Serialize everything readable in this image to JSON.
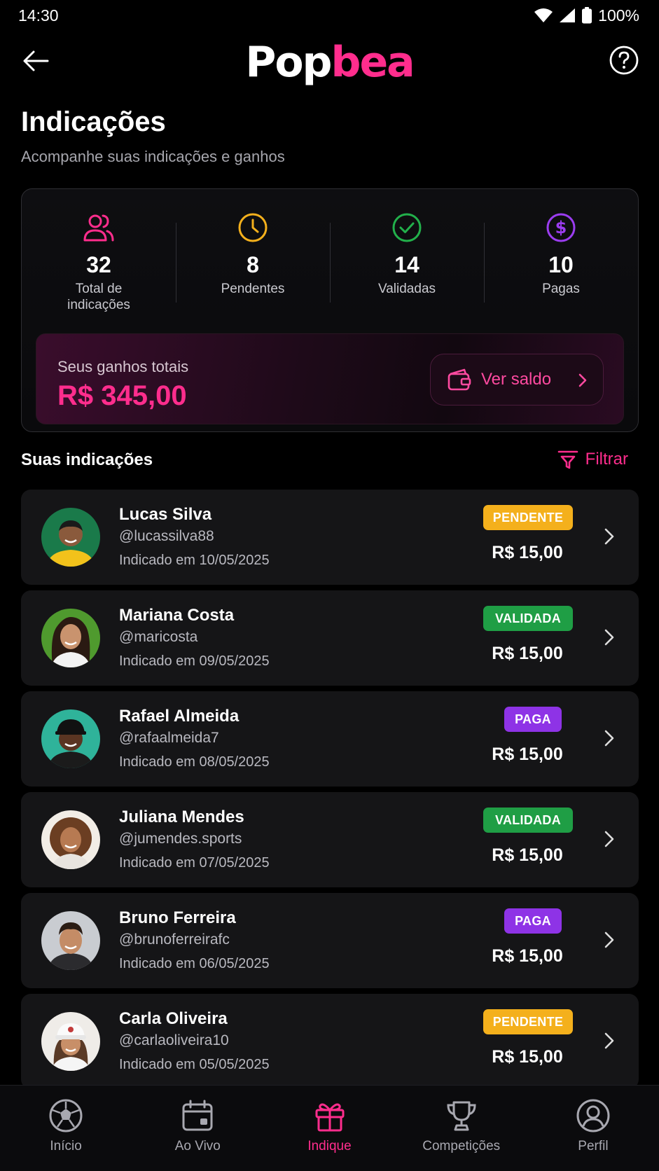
{
  "status_bar": {
    "time": "14:30",
    "battery": "100%"
  },
  "header": {
    "logo_part1": "Pop",
    "logo_part2": "bea"
  },
  "page": {
    "title": "Indicações",
    "subtitle": "Acompanhe suas indicações e ganhos"
  },
  "stats": [
    {
      "icon": "users-icon",
      "value": "32",
      "label": "Total de indicações",
      "color": "#ff2d8d"
    },
    {
      "icon": "clock-icon",
      "value": "8",
      "label": "Pendentes",
      "color": "#f4b01c"
    },
    {
      "icon": "check-circle-icon",
      "value": "14",
      "label": "Validadas",
      "color": "#22b04b"
    },
    {
      "icon": "dollar-circle-icon",
      "value": "10",
      "label": "Pagas",
      "color": "#9b3df0"
    }
  ],
  "earnings": {
    "label": "Seus ganhos totais",
    "value": "R$ 345,00",
    "button_label": "Ver saldo"
  },
  "list": {
    "title": "Suas indicações",
    "filter_label": "Filtrar"
  },
  "referrals": [
    {
      "name": "Lucas Silva",
      "handle": "@lucassilva88",
      "date": "Indicado em 10/05/2025",
      "status": "PENDENTE",
      "amount": "R$ 15,00",
      "status_color": "#f4b01c",
      "status_text_color": "#ffffff"
    },
    {
      "name": "Mariana Costa",
      "handle": "@maricosta",
      "date": "Indicado em 09/05/2025",
      "status": "VALIDADA",
      "amount": "R$ 15,00",
      "status_color": "#1f9e45",
      "status_text_color": "#ffffff"
    },
    {
      "name": "Rafael Almeida",
      "handle": "@rafaalmeida7",
      "date": "Indicado em 08/05/2025",
      "status": "PAGA",
      "amount": "R$ 15,00",
      "status_color": "#8e33e6",
      "status_text_color": "#ffffff"
    },
    {
      "name": "Juliana Mendes",
      "handle": "@jumendes.sports",
      "date": "Indicado em 07/05/2025",
      "status": "VALIDADA",
      "amount": "R$ 15,00",
      "status_color": "#1f9e45",
      "status_text_color": "#ffffff"
    },
    {
      "name": "Bruno Ferreira",
      "handle": "@brunoferreirafc",
      "date": "Indicado em 06/05/2025",
      "status": "PAGA",
      "amount": "R$ 15,00",
      "status_color": "#8e33e6",
      "status_text_color": "#ffffff"
    },
    {
      "name": "Carla Oliveira",
      "handle": "@carlaoliveira10",
      "date": "Indicado em 05/05/2025",
      "status": "PENDENTE",
      "amount": "R$ 15,00",
      "status_color": "#f4b01c",
      "status_text_color": "#ffffff"
    }
  ],
  "nav": [
    {
      "label": "Início",
      "icon": "soccer-ball-icon",
      "active": false
    },
    {
      "label": "Ao Vivo",
      "icon": "calendar-live-icon",
      "active": false
    },
    {
      "label": "Indique",
      "icon": "gift-icon",
      "active": true
    },
    {
      "label": "Competições",
      "icon": "trophy-icon",
      "active": false
    },
    {
      "label": "Perfil",
      "icon": "user-circle-icon",
      "active": false
    }
  ],
  "colors": {
    "accent": "#ff2d8d",
    "background": "#000000",
    "card": "#151517"
  }
}
